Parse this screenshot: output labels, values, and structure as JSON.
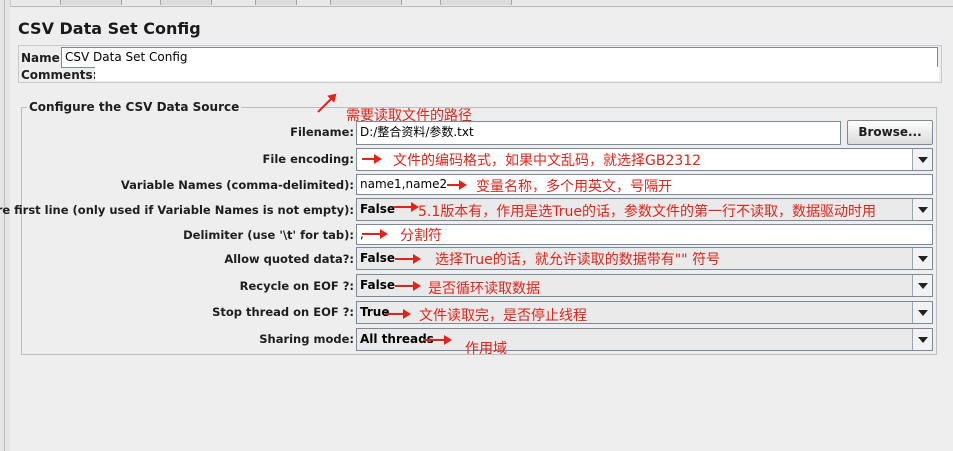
{
  "panel": {
    "title": "CSV Data Set Config",
    "name_label": "Name:",
    "name_value": "CSV Data Set Config",
    "comments_label": "Comments:",
    "comments_value": ""
  },
  "source": {
    "legend": "Configure the CSV Data Source",
    "filename_label": "Filename:",
    "filename_value": "D:/整合资料/参数.txt",
    "browse_label": "Browse...",
    "encoding_label": "File encoding:",
    "encoding_value": "",
    "varnames_label": "Variable Names (comma-delimited):",
    "varnames_value": "name1,name2",
    "ignore_label": "Ignore first line (only used if Variable Names is not empty):",
    "ignore_value": "False",
    "delimiter_label": "Delimiter (use '\\t' for tab):",
    "delimiter_value": ",",
    "quoted_label": "Allow quoted data?:",
    "quoted_value": "False",
    "recycle_label": "Recycle on EOF ?:",
    "recycle_value": "False",
    "stop_label": "Stop thread on EOF ?:",
    "stop_value": "True",
    "sharing_label": "Sharing mode:",
    "sharing_value": "All threads"
  },
  "annotations": {
    "filename": "需要读取文件的路径",
    "encoding": "文件的编码格式，如果中文乱码，就选择GB2312",
    "varnames": "变量名称，多个用英文，号隔开",
    "ignore": "5.1版本有，作用是选True的话，参数文件的第一行不读取，数据驱动时用",
    "delimiter": "分割符",
    "quoted": "选择True的话，就允许读取的数据带有\"\" 符号",
    "recycle": "是否循环读取数据",
    "stop": "文件读取完，是否停止线程",
    "sharing": "作用域"
  },
  "colors": {
    "annotation": "#e2231a",
    "background": "#eeeeee"
  }
}
